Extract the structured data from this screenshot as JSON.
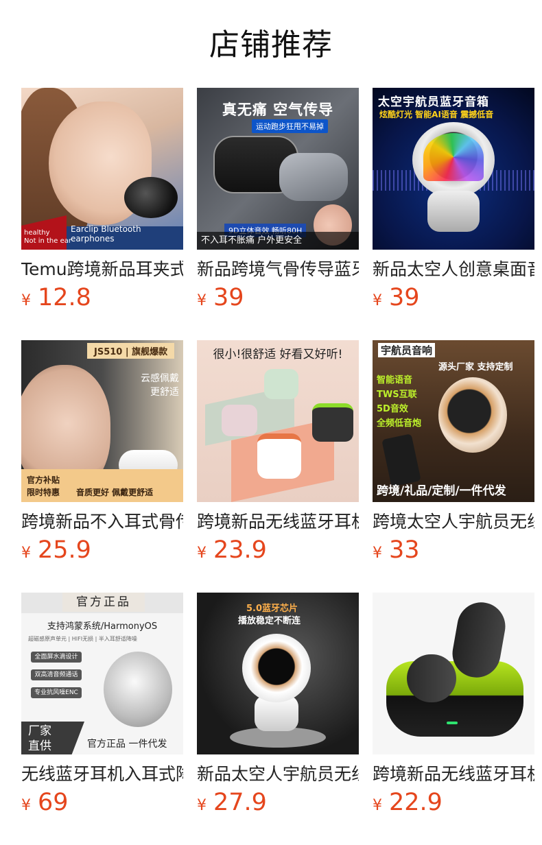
{
  "title": "店铺推荐",
  "currency": "¥",
  "colors": {
    "price": "#e5461d"
  },
  "products": [
    {
      "name": "Temu跨境新品耳夹式蓝牙耳机",
      "price": "12.8",
      "image_text": {
        "badge": "healthy\nNot in the ear",
        "strip": "Earclip Bluetooth earphones"
      }
    },
    {
      "name": "新品跨境气骨传导蓝牙耳机",
      "price": "39",
      "image_text": {
        "headline": "真无痛 空气传导",
        "sub": "运动跑步狂甩不易掉",
        "specs": "9D立体音效 畅听80H",
        "bottom": "不入耳不胀痛 户外更安全"
      }
    },
    {
      "name": "新品太空人创意桌面音箱",
      "price": "39",
      "image_text": {
        "headline": "太空宇航员蓝牙音箱",
        "sub": "炫酷灯光 智能AI语音 震撼低音"
      }
    },
    {
      "name": "跨境新品不入耳式骨传导耳机",
      "price": "25.9",
      "image_text": {
        "top": "JS510 | 旗舰爆款",
        "side": "云感佩戴\n更舒适",
        "b1": "官方补贴",
        "b2": "限时特惠",
        "b3": "音质更好 佩戴更舒适"
      }
    },
    {
      "name": "跨境新品无线蓝牙耳机",
      "price": "23.9",
      "image_text": {
        "headline": "很小!很舒适 好看又好听!"
      }
    },
    {
      "name": "跨境太空人宇航员无线音箱",
      "price": "33",
      "image_text": {
        "headline": "宇航员音响",
        "sub": "源头厂家 支持定制",
        "features": "智能语音\nTWS互联\n5D音效\n全频低音炮",
        "bottom": "跨境/礼品/定制/一件代发"
      }
    },
    {
      "name": "无线蓝牙耳机入耳式降噪",
      "price": "69",
      "image_text": {
        "top": "官方正品",
        "headline": "支持鸿蒙系统/HarmonyOS",
        "small": "超磁感原声单元 | HIFI无损 | 半入耳舒适降噪",
        "tags": [
          "全面屏水滴设计",
          "双高清音频通话",
          "专业抗风噪ENC"
        ],
        "b1": "厂家",
        "b2": "直供",
        "b3": "官方正品 一件代发"
      }
    },
    {
      "name": "新品太空人宇航员无线音箱",
      "price": "27.9",
      "image_text": {
        "h1": "5.0蓝牙芯片",
        "h2": "播放稳定不断连"
      }
    },
    {
      "name": "跨境新品无线蓝牙耳机",
      "price": "22.9",
      "image_text": {}
    }
  ]
}
